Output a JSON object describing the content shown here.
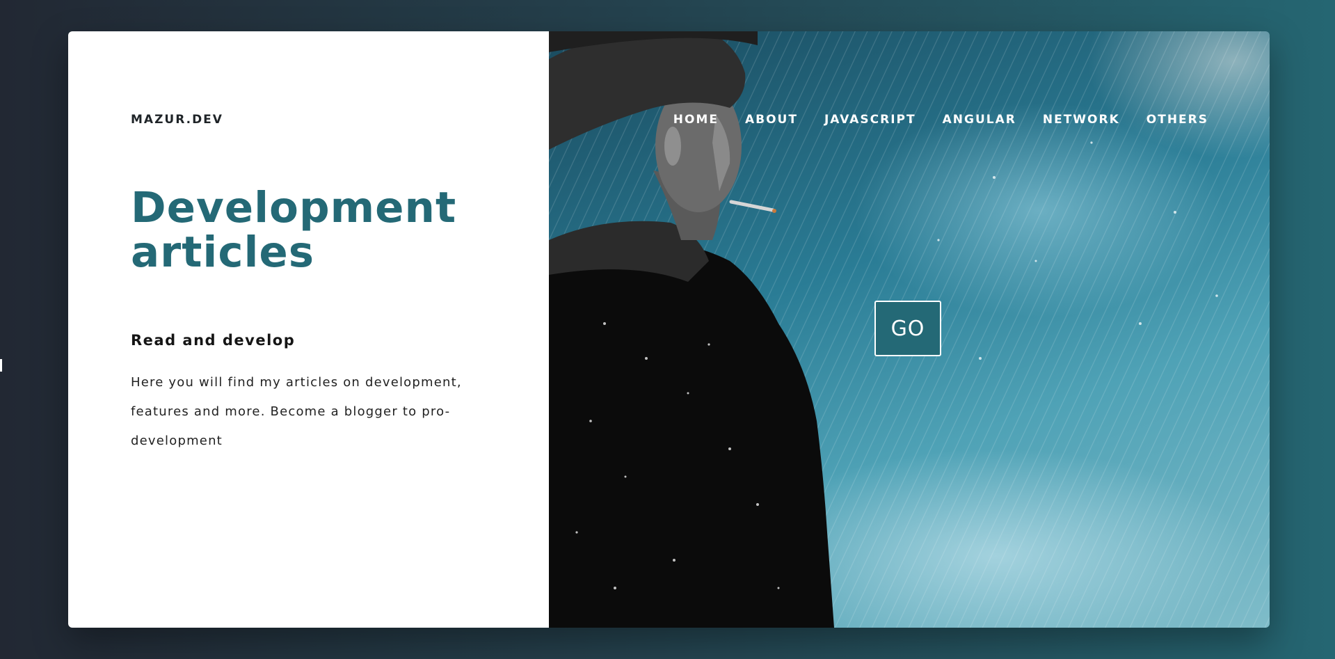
{
  "brand": "MAZUR.DEV",
  "hero": {
    "title_line1": "Development",
    "title_line2": "articles",
    "subtitle": "Read and develop",
    "description": "Here you will find my articles on development, features and more. Become a blogger to pro-development"
  },
  "nav": {
    "items": [
      {
        "label": "HOME"
      },
      {
        "label": "ABOUT"
      },
      {
        "label": "JAVASCRIPT"
      },
      {
        "label": "ANGULAR"
      },
      {
        "label": "NETWORK"
      },
      {
        "label": "OTHERS"
      }
    ]
  },
  "cta": {
    "label": "GO"
  },
  "colors": {
    "accent": "#246976",
    "background_left": "#222833",
    "background_right": "#256672",
    "card": "#ffffff"
  }
}
